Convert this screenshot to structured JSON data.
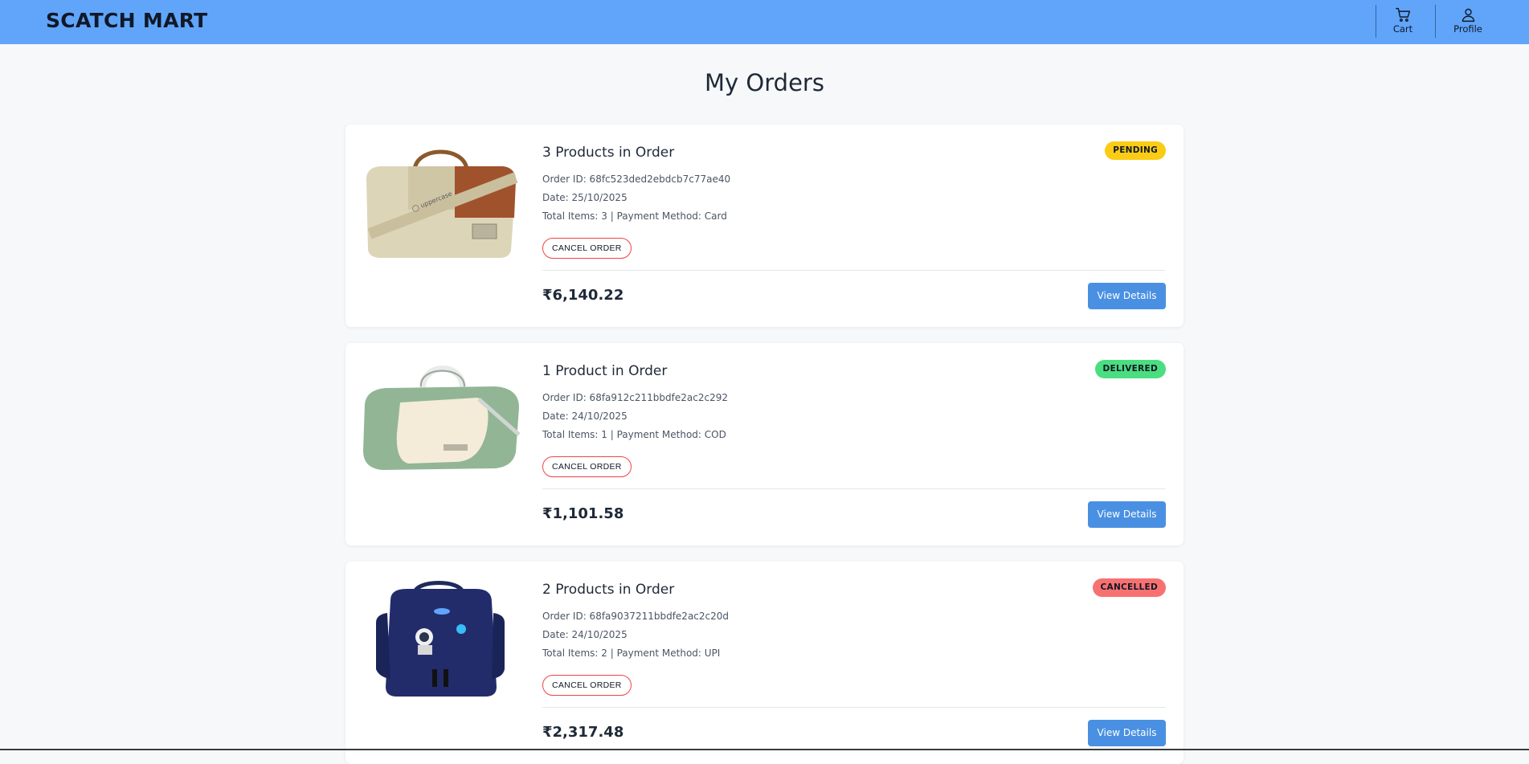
{
  "header": {
    "brand": "SCATCH MART",
    "cart_label": "Cart",
    "profile_label": "Profile"
  },
  "page": {
    "title": "My Orders"
  },
  "colors": {
    "navbar": "#60a5fa",
    "pending": "#facc15",
    "delivered": "#4ade80",
    "cancelled": "#f87171",
    "view_button": "#4a90e2",
    "cancel_border": "#ef4444"
  },
  "orders": [
    {
      "title": "3 Products in Order",
      "order_id": "Order ID: 68fc523ded2ebdcb7c77ae40",
      "date": "Date: 25/10/2025",
      "items_payment": "Total Items: 3 | Payment Method: Card",
      "status": "PENDING",
      "status_color": "#facc15",
      "cancel_label": "CANCEL ORDER",
      "price": "₹6,140.22",
      "view_label": "View Details",
      "image": "duffel-bag-beige-brown"
    },
    {
      "title": "1 Product in Order",
      "order_id": "Order ID: 68fa912c211bbdfe2ac2c292",
      "date": "Date: 24/10/2025",
      "items_payment": "Total Items: 1 | Payment Method: COD",
      "status": "DELIVERED",
      "status_color": "#4ade80",
      "cancel_label": "CANCEL ORDER",
      "price": "₹1,101.58",
      "view_label": "View Details",
      "image": "duffel-bag-green-cream"
    },
    {
      "title": "2 Products in Order",
      "order_id": "Order ID: 68fa9037211bbdfe2ac2c20d",
      "date": "Date: 24/10/2025",
      "items_payment": "Total Items: 2 | Payment Method: UPI",
      "status": "CANCELLED",
      "status_color": "#f87171",
      "cancel_label": "CANCEL ORDER",
      "price": "₹2,317.48",
      "view_label": "View Details",
      "image": "backpack-navy-astronaut"
    }
  ]
}
